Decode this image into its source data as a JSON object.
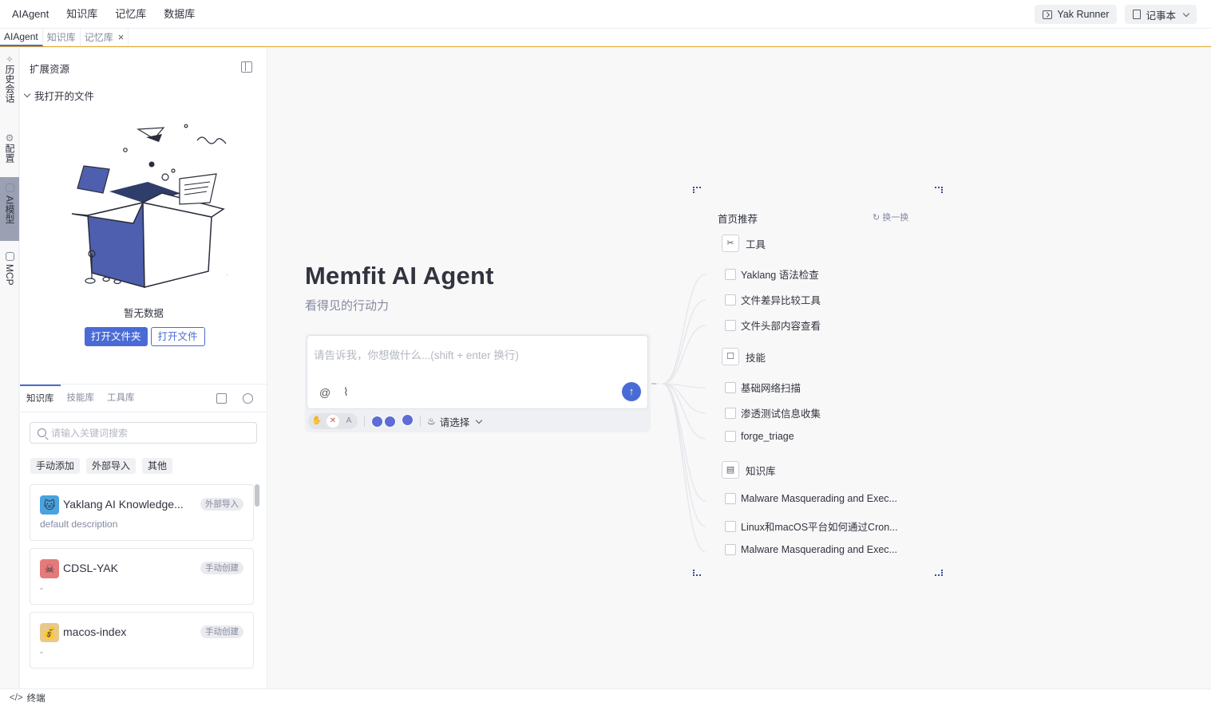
{
  "topbar": {
    "menu": [
      "AIAgent",
      "知识库",
      "记忆库",
      "数据库"
    ],
    "yak_runner": "Yak Runner",
    "notebook": "记事本"
  },
  "tabs": [
    {
      "label": "AIAgent",
      "active": true
    },
    {
      "label": "知识库",
      "active": false
    },
    {
      "label": "记忆库",
      "active": false,
      "closable": true
    }
  ],
  "rail": [
    {
      "label": "历史会话",
      "icon": "sparkle-icon"
    },
    {
      "label": "配置",
      "icon": "gear-icon"
    },
    {
      "label": "AI模型",
      "icon": "model-icon",
      "active": true
    },
    {
      "label": "MCP",
      "icon": "mcp-icon"
    }
  ],
  "side": {
    "title": "扩展资源",
    "folder_section": "我打开的文件",
    "empty_text": "暂无数据",
    "open_folder": "打开文件夹",
    "open_file": "打开文件",
    "bottom_tabs": [
      "知识库",
      "技能库",
      "工具库"
    ],
    "search_placeholder": "请输入关键词搜索",
    "filters": [
      "手动添加",
      "外部导入",
      "其他"
    ],
    "cards": [
      {
        "name": "Yaklang AI Knowledge...",
        "tag": "外部导入",
        "desc": "default description",
        "avatar_color": "#4aa3df",
        "icon": "cat-icon"
      },
      {
        "name": "CDSL-YAK",
        "tag": "手动创建",
        "desc": "-",
        "avatar_color": "#e57a7a",
        "icon": "skull-icon"
      },
      {
        "name": "macos-index",
        "tag": "手动创建",
        "desc": "-",
        "avatar_color": "#e8c98a",
        "icon": "money-bag-icon"
      }
    ]
  },
  "main": {
    "title": "Memfit AI Agent",
    "subtitle": "看得见的行动力",
    "input_placeholder": "请告诉我，你想做什么...(shift + enter 换行)",
    "select_label": "请选择"
  },
  "recommend": {
    "title": "首页推荐",
    "refresh": "换一换",
    "groups": [
      {
        "label": "工具",
        "icon": "tool-icon",
        "items": [
          "Yaklang 语法检查",
          "文件差异比较工具",
          "文件头部内容查看"
        ]
      },
      {
        "label": "技能",
        "icon": "robot-icon",
        "items": [
          "基础网络扫描",
          "渗透测试信息收集",
          "forge_triage"
        ]
      },
      {
        "label": "知识库",
        "icon": "book-icon",
        "items": [
          "Malware Masquerading and Exec...",
          "Linux和macOS平台如何通过Cron...",
          "Malware Masquerading and Exec..."
        ]
      }
    ]
  },
  "statusbar": {
    "terminal": "终端"
  }
}
